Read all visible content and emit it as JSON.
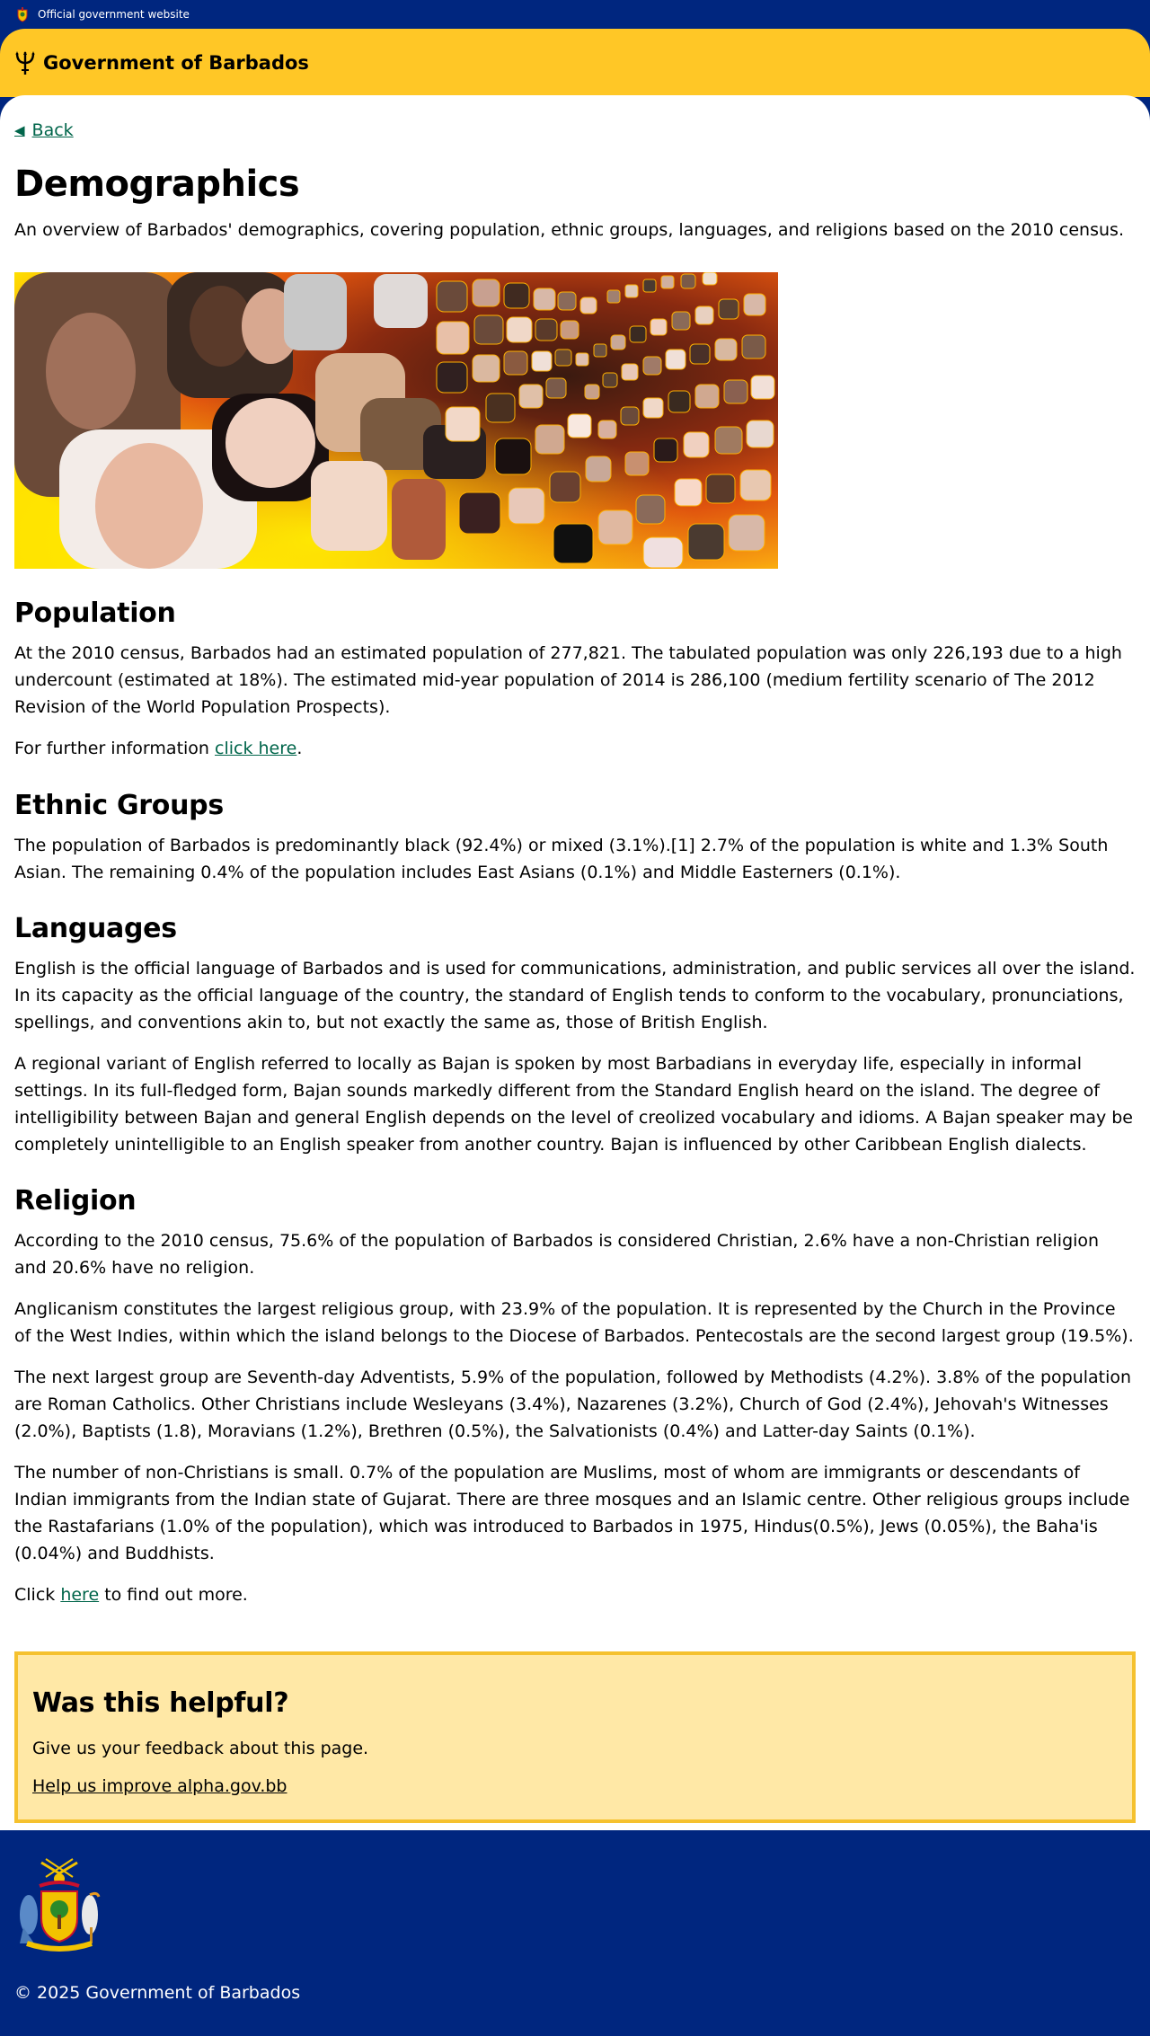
{
  "top_strip": {
    "text": "Official government website"
  },
  "header": {
    "site_name": "Government of Barbados"
  },
  "nav": {
    "back_label": "Back"
  },
  "page": {
    "title": "Demographics",
    "lead": "An overview of Barbados' demographics, covering population, ethnic groups, languages, and religions based on the 2010 census."
  },
  "sections": {
    "population": {
      "heading": "Population",
      "p1": "At the 2010 census, Barbados had an estimated population of 277,821. The tabulated population was only 226,193 due to a high undercount (estimated at 18%). The estimated mid-year population of 2014 is 286,100 (medium fertility scenario of The 2012 Revision of the World Population Prospects).",
      "p2_prefix": "For further information ",
      "p2_link": "click here",
      "p2_suffix": "."
    },
    "ethnic": {
      "heading": "Ethnic Groups",
      "p1": "The population of Barbados is predominantly black (92.4%) or mixed (3.1%).[1] 2.7% of the population is white and 1.3% South Asian. The remaining 0.4% of the population includes East Asians (0.1%) and Middle Easterners (0.1%)."
    },
    "languages": {
      "heading": "Languages",
      "p1": "English is the official language of Barbados and is used for communications, administration, and public services all over the island. In its capacity as the official language of the country, the standard of English tends to conform to the vocabulary, pronunciations, spellings, and conventions akin to, but not exactly the same as, those of British English.",
      "p2": "A regional variant of English referred to locally as Bajan is spoken by most Barbadians in everyday life, especially in informal settings. In its full-fledged form, Bajan sounds markedly different from the Standard English heard on the island. The degree of intelligibility between Bajan and general English depends on the level of creolized vocabulary and idioms. A Bajan speaker may be completely unintelligible to an English speaker from another country. Bajan is influenced by other Caribbean English dialects."
    },
    "religion": {
      "heading": "Religion",
      "p1": "According to the 2010 census, 75.6% of the population of Barbados is considered Christian, 2.6% have a non-Christian religion and 20.6% have no religion.",
      "p2": "Anglicanism constitutes the largest religious group, with 23.9% of the population. It is represented by the Church in the Province of the West Indies, within which the island belongs to the Diocese of Barbados. Pentecostals are the second largest group (19.5%).",
      "p3": "The next largest group are Seventh-day Adventists, 5.9% of the population, followed by Methodists (4.2%). 3.8% of the population are Roman Catholics. Other Christians include Wesleyans (3.4%), Nazarenes (3.2%), Church of God (2.4%), Jehovah's Witnesses (2.0%), Baptists (1.8), Moravians (1.2%), Brethren (0.5%), the Salvationists (0.4%) and Latter-day Saints (0.1%).",
      "p4": "The number of non-Christians is small. 0.7% of the population are Muslims, most of whom are immigrants or descendants of Indian immigrants from the Indian state of Gujarat. There are three mosques and an Islamic centre. Other religious groups include the Rastafarians (1.0% of the population), which was introduced to Barbados in 1975, Hindus(0.5%), Jews (0.05%), the Baha'is (0.04%) and Buddhists.",
      "p5_prefix": "Click ",
      "p5_link": "here",
      "p5_suffix": " to find out more."
    }
  },
  "feedback": {
    "heading": "Was this helpful?",
    "text": "Give us your feedback about this page.",
    "link": "Help us improve alpha.gov.bb"
  },
  "footer": {
    "copyright": "© 2025 Government of Barbados"
  },
  "colors": {
    "navy": "#00267f",
    "gold": "#ffc726",
    "link_green": "#00654a",
    "feedback_bg": "#ffe8a6",
    "feedback_border": "#f5c12e"
  },
  "icons": {
    "strip_crest": "coat-of-arms-icon",
    "header_logo": "trident-icon",
    "back": "arrow-left-icon",
    "footer_crest": "coat-of-arms-icon"
  }
}
